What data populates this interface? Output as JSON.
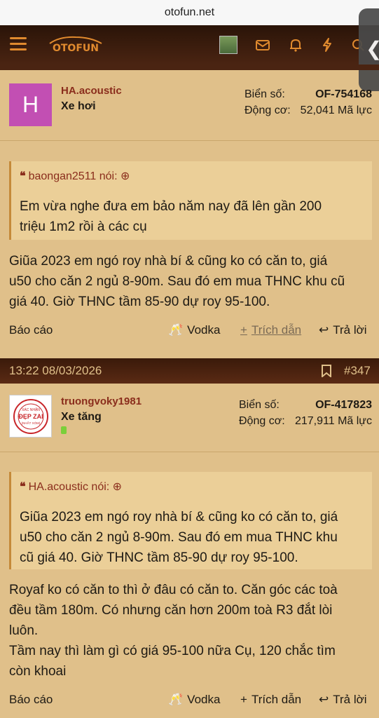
{
  "browser": {
    "url": "otofun.net"
  },
  "nav": {
    "logo_text": "OTOFUN",
    "icons": [
      "menu-icon",
      "avatar",
      "mail-icon",
      "bell-icon",
      "bolt-icon",
      "search-icon"
    ]
  },
  "post1": {
    "username": "HA.acoustic",
    "user_title": "Xe hơi",
    "avatar_letter": "H",
    "plate_label": "Biển số:",
    "plate_value": "OF-754168",
    "engine_label": "Động cơ:",
    "engine_value": "52,041 Mã lực",
    "quote_author": "baongan2511 nói:",
    "quote_line1": "Em vừa nghe đưa em bảo năm nay đã lên gần 200",
    "quote_line2": "triệu 1m2 rồi à các cụ",
    "message_line1": "Giũa 2023 em ngó roy nhà bí & cũng ko có căn to, giá",
    "message_line2": "u50 cho căn 2 ngủ 8-90m. Sau đó em mua THNC khu cũ",
    "message_line3": "giá 40. Giờ THNC tầm 85-90 dự roy 95-100.",
    "report": "Báo cáo",
    "like": "Vodka",
    "quote": "Trích dẫn",
    "reply": "Trả lời"
  },
  "post2": {
    "timestamp": "13:22 08/03/2026",
    "post_number": "#347",
    "username": "truongvoky1981",
    "user_title": "Xe tăng",
    "avatar_text_top": "XÁC NHẬN",
    "avatar_text_main": "ĐẸP ZAI",
    "avatar_text_sub": "(NHẤT XÓM)",
    "plate_label": "Biển số:",
    "plate_value": "OF-417823",
    "engine_label": "Động cơ:",
    "engine_value": "217,911 Mã lực",
    "quote_author": "HA.acoustic nói:",
    "quote_line1": "Giũa 2023 em ngó roy nhà bí & cũng ko có căn to, giá",
    "quote_line2": "u50 cho căn 2 ngủ 8-90m. Sau đó em mua THNC khu",
    "quote_line3": "cũ giá 40. Giờ THNC tầm 85-90 dự roy 95-100.",
    "message_line1": "Royaf ko có căn to thì ở đâu có căn to. Căn góc các toà",
    "message_line2": "đều tầm 180m. Có nhưng căn hơn 200m toà R3 đắt lòi",
    "message_line3": "luôn.",
    "message_line4": "Tầm nay thì làm gì có giá 95-100 nữa Cụ, 120 chắc tìm",
    "message_line5": "còn khoai",
    "report": "Báo cáo",
    "like": "Vodka",
    "quote": "Trích dẫn",
    "reply": "Trả lời"
  },
  "colors": {
    "background": "#e0c08a",
    "header": "#3a1a0a",
    "username": "#8a2d1c",
    "accent": "#e08a2e"
  }
}
